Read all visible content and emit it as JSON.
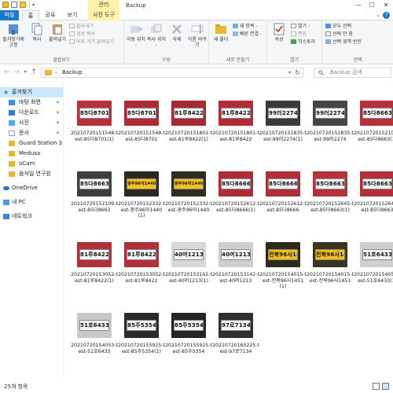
{
  "window": {
    "title": "Backup",
    "context_tab_label": "관리",
    "minimize": "—",
    "maximize": "☐",
    "close": "✕"
  },
  "ribbon_tabs": {
    "file": "파일",
    "home": "홈",
    "share": "공유",
    "view": "보기",
    "picture_tools": "사진 도구",
    "help": "?"
  },
  "ribbon": {
    "clipboard": {
      "label": "클립보드",
      "pin_quick": "즐겨찾기에 고정",
      "copy": "복사",
      "paste": "붙여넣기",
      "cut": "잘라내기",
      "copy_path": "경로 복사",
      "paste_shortcut": "바로 가기 붙여넣기"
    },
    "organize": {
      "label": "구성",
      "move_to": "이동 위치 -",
      "copy_to": "복사 위치 -",
      "delete": "삭제",
      "rename": "이름 바꾸기"
    },
    "new": {
      "label": "새로 만들기",
      "new_folder": "새 폴더",
      "new_item": "새 항목 -",
      "easy_access": "빠른 연결 -"
    },
    "open": {
      "label": "열기",
      "properties": "속성",
      "open": "열기 -",
      "edit": "편집",
      "history": "히스토리"
    },
    "select": {
      "label": "선택",
      "select_all": "모두 선택",
      "select_none": "선택 안 함",
      "invert": "선택 영역 반전"
    }
  },
  "address": {
    "path": "Backup",
    "separator": "›",
    "search_placeholder": "Backup 검색"
  },
  "nav": {
    "items": [
      {
        "label": "즐겨찾기",
        "icon": "star-icon"
      },
      {
        "label": "바탕 화면",
        "icon": "desktop-icon",
        "pinned": true
      },
      {
        "label": "다운로드",
        "icon": "download-icon",
        "pinned": true
      },
      {
        "label": "사진",
        "icon": "pictures-icon",
        "pinned": true
      },
      {
        "label": "문서",
        "icon": "documents-icon",
        "pinned": true
      },
      {
        "label": "Guard Station 3",
        "icon": "folder-icon"
      },
      {
        "label": "Medusa",
        "icon": "folder-icon"
      },
      {
        "label": "oCam",
        "icon": "folder-icon"
      },
      {
        "label": "음식일 연구원",
        "icon": "folder-icon"
      },
      {
        "label": "OneDrive",
        "icon": "cloud-icon"
      },
      {
        "label": "내 PC",
        "icon": "pc-icon"
      },
      {
        "label": "네트워크",
        "icon": "network-icon"
      }
    ],
    "pin_glyph": "📌"
  },
  "files": [
    {
      "name": "20210720151548-test-85다8701(1)",
      "plate": "85다8701",
      "bg": "#b8303a"
    },
    {
      "name": "20210720151548-test-85다8701",
      "plate": "85다8701",
      "bg": "#b02a35"
    },
    {
      "name": "20210720151801-test-81루8422(1)",
      "plate": "81루8422",
      "bg": "#a82833"
    },
    {
      "name": "20210720151801-test-81루8422",
      "plate": "81루8422",
      "bg": "#b22c38"
    },
    {
      "name": "20210720151835-test-99러2274(1)",
      "plate": "99러2274",
      "bg": "#3a3a3a"
    },
    {
      "name": "20210720151835-test-99러2274",
      "plate": "99러2274",
      "bg": "#454545"
    },
    {
      "name": "20210720152109-test-85다8663(1)",
      "plate": "85다8663",
      "bg": "#b5303a"
    },
    {
      "name": "20210720152109-test-85다8663",
      "plate": "85다8663",
      "bg": "#3f3f3f"
    },
    {
      "name": "20210720152332-test-광주96아1440(1)",
      "plate": "광주96아1440",
      "bg": "#2a2a22"
    },
    {
      "name": "20210720152332-test-광주96아1440",
      "plate": "광주96아1440",
      "bg": "#2f2e25"
    },
    {
      "name": "20210720152612-test-85다8666(1)",
      "plate": "85다8666",
      "bg": "#ad2d37"
    },
    {
      "name": "20210720152612-test-85다8666",
      "plate": "85다8666",
      "bg": "#b02e38"
    },
    {
      "name": "20210720152645-test-85다8663(1)",
      "plate": "85다8663",
      "bg": "#b8323c"
    },
    {
      "name": "20210720152645-test-85다8663",
      "plate": "85다8663",
      "bg": "#b42f39"
    },
    {
      "name": "20210720153052-test-81루8422(1)",
      "plate": "81루8422",
      "bg": "#b0303a"
    },
    {
      "name": "20210720153052-test-81루8422",
      "plate": "81루8422",
      "bg": "#b22f39"
    },
    {
      "name": "20210720153142-test-40머1213(1)",
      "plate": "40머1213",
      "bg": "#d8d8d8"
    },
    {
      "name": "20210720153142-test-40머1213",
      "plate": "40머1213",
      "bg": "#cfcfcf"
    },
    {
      "name": "20210720154015-test-전북96사1451(1)",
      "plate": "전북96사1451",
      "bg": "#2c2c1c"
    },
    {
      "name": "20210720154015-test-전북96사1451",
      "plate": "전북96사1451",
      "bg": "#3a3520"
    },
    {
      "name": "20210720154053-test-51호6433(1)",
      "plate": "51호6433",
      "bg": "#cfcfcf"
    },
    {
      "name": "20210720154053-test-51호6433",
      "plate": "51호6433",
      "bg": "#c8c8c8"
    },
    {
      "name": "20210720155925-test-85주5354(1)",
      "plate": "85주5354",
      "bg": "#2b2b2b"
    },
    {
      "name": "20210720155925-test-85주5354",
      "plate": "85주5354",
      "bg": "#252525"
    },
    {
      "name": "20210720160225-test-97로7134",
      "plate": "97로7134",
      "bg": "#303030"
    }
  ],
  "status": {
    "count": "25개 항목"
  }
}
